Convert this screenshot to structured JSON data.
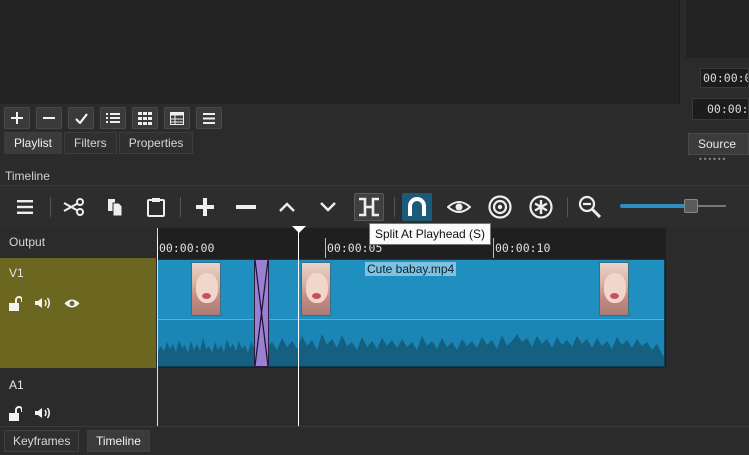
{
  "playlist": {
    "toolbar_buttons": [
      "add-icon",
      "remove-icon",
      "check-icon",
      "list-view-icon",
      "grid-view-icon",
      "detail-view-icon",
      "menu-icon"
    ],
    "tabs": [
      {
        "label": "Playlist",
        "active": true
      },
      {
        "label": "Filters",
        "active": false
      },
      {
        "label": "Properties",
        "active": false
      }
    ]
  },
  "source": {
    "timecode_position": "00:00:00",
    "timecode_duration": "00:00:",
    "tab_label": "Source"
  },
  "timeline": {
    "title": "Timeline",
    "toolbar_icons": [
      "menu-icon",
      "cut-icon",
      "copy-icon",
      "paste-icon",
      "append-icon",
      "remove-icon",
      "lift-icon",
      "overwrite-icon",
      "split-icon",
      "snap-icon",
      "scrub-icon",
      "ripple-icon",
      "ripple-all-icon",
      "zoom-out-icon"
    ],
    "tooltip": "Split At Playhead (S)",
    "zoom_level": 0.62,
    "ruler": {
      "ticks": [
        "00:00:00",
        "00:00:05",
        "00:00:10"
      ]
    },
    "tracks": {
      "output_label": "Output",
      "v1": {
        "name": "V1"
      },
      "a1": {
        "name": "A1"
      }
    },
    "clips": [
      {
        "name": "Cute babay.mp4"
      }
    ]
  },
  "bottom_tabs": [
    {
      "label": "Keyframes",
      "active": false
    },
    {
      "label": "Timeline",
      "active": true
    }
  ],
  "colors": {
    "accent": "#2d8fc1",
    "clip": "#1f8fbf",
    "transition": "#9b7fd1",
    "track_selected": "#6b6620"
  }
}
